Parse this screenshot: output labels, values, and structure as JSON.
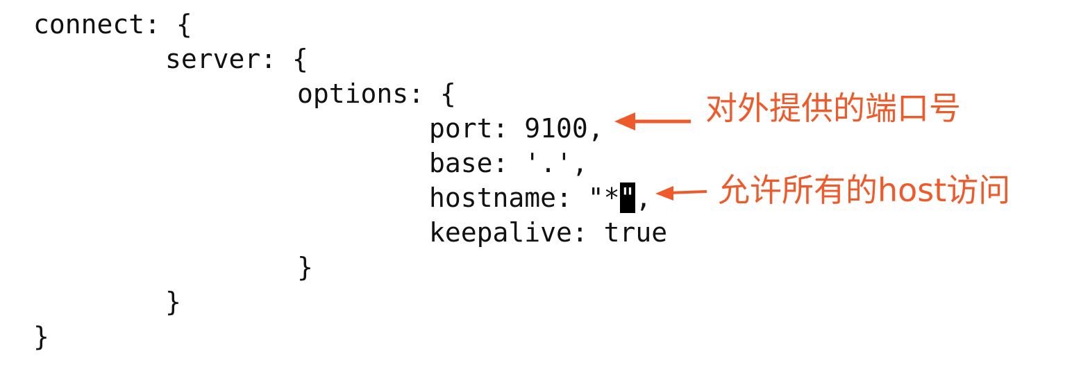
{
  "code": {
    "lines": [
      "connect: {",
      "server: {",
      "options: {",
      "port: 9100,",
      "base: '.',",
      "hostname: \"*",
      "\"",
      ",",
      "keepalive: true",
      "}",
      "}",
      "}"
    ]
  },
  "annotations": {
    "port_note": "对外提供的端口号",
    "hostname_note": "允许所有的host访问"
  },
  "colors": {
    "annotation": "#ee5a2a",
    "text": "#111111",
    "background": "#ffffff",
    "cursor": "#000000"
  }
}
